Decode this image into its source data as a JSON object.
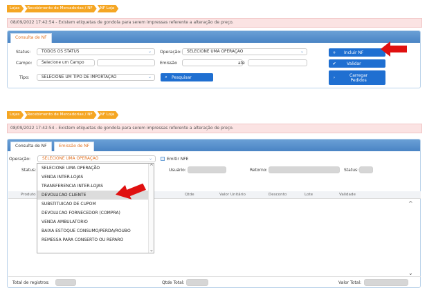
{
  "breadcrumb": [
    "Lojas",
    "Recebimento de Mercadorias / NF",
    "NF Loja"
  ],
  "alert": "08/09/2022 17:42:54 - Existem etiquetas de gondola para serem impressas referente a alteração de preço.",
  "top": {
    "tab": "Consulta de NF",
    "status_label": "Status:",
    "status_value": "TODOS OS STATUS",
    "operacao_label": "Operação:",
    "operacao_value": "SELECIONE UMA OPERAÇÃO",
    "campo_label": "Campo:",
    "campo_value": "Selecione um Campo",
    "emissao_label": "Emissão",
    "ate_label": "até",
    "tipo_label": "Tipo:",
    "tipo_value": "SELECIONE UM TIPO DE IMPORTAÇÃO",
    "pesquisar": "Pesquisar",
    "incluir": "Incluir NF",
    "validar": "Validar",
    "carregar": [
      "Carregar",
      "Pedidos"
    ]
  },
  "bottom": {
    "tabs": [
      "Consulta de NF",
      "Emissão de NF"
    ],
    "operacao_label": "Operação:",
    "operacao_value": "SELECIONE UMA OPERAÇÃO",
    "emitir_nfe": "Emitir NFE",
    "status_label": "Status:",
    "usuario_label": "Usuário:",
    "retorno_label": "Retorno:",
    "status2_label": "Status:",
    "produto_label": "Produto",
    "columns": [
      "Qtde",
      "Valor Unitário",
      "Desconto",
      "Lote",
      "Validade"
    ],
    "dropdown_options": [
      "SELECIONE UMA OPERAÇÃO",
      "VENDA INTER-LOJAS",
      "TRANSFERENCIA INTER-LOJAS",
      "DEVOLUCAO CLIENTE",
      "SUBSTITUICAO DE CUPOM",
      "DEVOLUCAO FORNECEDOR (COMPRA)",
      "VENDA AMBULATORIO",
      "BAIXA ESTOQUE CONSUMO/PERDA/ROUBO",
      "REMESSA PARA CONSERTO OU REPARO"
    ],
    "total_registros": "Total de registros:",
    "qtde_total": "Qtde Total:",
    "valor_total": "Valor Total:"
  },
  "colors": {
    "accent": "#f5a623",
    "blue": "#1f6fd1",
    "arrow": "#e01010"
  }
}
